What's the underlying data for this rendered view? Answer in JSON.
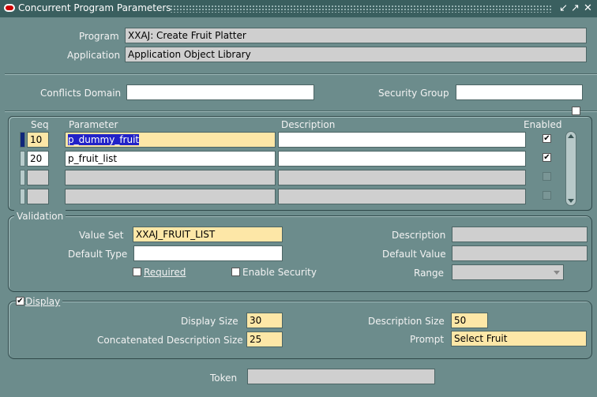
{
  "window": {
    "title": "Concurrent Program Parameters",
    "controls": {
      "min": "↙",
      "max": "↗",
      "close": "✕"
    }
  },
  "header": {
    "program_label": "Program",
    "program_value": "XXAJ: Create Fruit Platter",
    "application_label": "Application",
    "application_value": "Application Object Library",
    "conflicts_label": "Conflicts Domain",
    "conflicts_value": "",
    "security_label": "Security Group",
    "security_value": ""
  },
  "table": {
    "columns": {
      "seq": "Seq",
      "parameter": "Parameter",
      "description": "Description",
      "enabled": "Enabled"
    },
    "rows": [
      {
        "seq": "10",
        "parameter": "p_dummy_fruit",
        "description": "",
        "enabled": true
      },
      {
        "seq": "20",
        "parameter": "p_fruit_list",
        "description": "",
        "enabled": true
      },
      {
        "seq": "",
        "parameter": "",
        "description": "",
        "enabled": false
      },
      {
        "seq": "",
        "parameter": "",
        "description": "",
        "enabled": false
      }
    ]
  },
  "validation": {
    "group_label": "Validation",
    "value_set_label": "Value Set",
    "value_set_value": "XXAJ_FRUIT_LIST",
    "default_type_label": "Default Type",
    "default_type_value": "",
    "required_label": "Required",
    "enable_security_label": "Enable Security",
    "description_label": "Description",
    "description_value": "",
    "default_value_label": "Default Value",
    "default_value_value": "",
    "range_label": "Range",
    "range_value": ""
  },
  "display": {
    "group_label": "Display",
    "checked": true,
    "display_size_label": "Display Size",
    "display_size_value": "30",
    "concat_size_label": "Concatenated Description Size",
    "concat_size_value": "25",
    "desc_size_label": "Description Size",
    "desc_size_value": "50",
    "prompt_label": "Prompt",
    "prompt_value": "Select Fruit"
  },
  "token": {
    "label": "Token",
    "value": ""
  }
}
